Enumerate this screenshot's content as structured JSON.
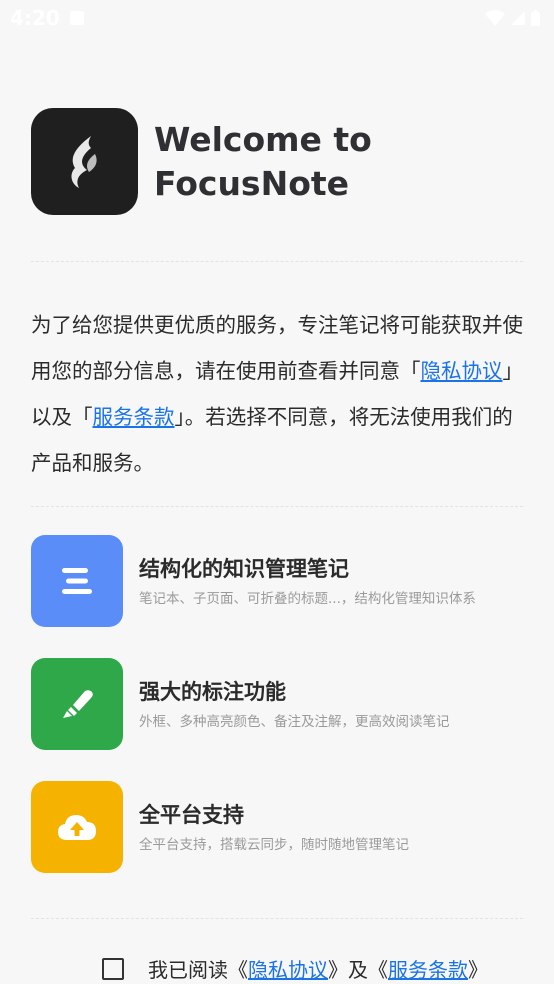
{
  "status": {
    "time": "4:20"
  },
  "header": {
    "line1": "Welcome to",
    "line2": "FocusNote"
  },
  "intro": {
    "part1": "为了给您提供更优质的服务，专注笔记将可能获取并使用您的部分信息，请在使用前查看并同意「",
    "privacy_link": "隐私协议",
    "part2": "」以及「",
    "terms_link": "服务条款",
    "part3": "」。若选择不同意，将无法使用我们的产品和服务。"
  },
  "features": [
    {
      "title": "结构化的知识管理笔记",
      "desc": "笔记本、子页面、可折叠的标题...，结构化管理知识体系",
      "color": "#5b8df8",
      "icon": "list-icon"
    },
    {
      "title": "强大的标注功能",
      "desc": "外框、多种高亮颜色、备注及注解，更高效阅读笔记",
      "color": "#2fa84a",
      "icon": "highlighter-icon"
    },
    {
      "title": "全平台支持",
      "desc": "全平台支持，搭载云同步，随时随地管理笔记",
      "color": "#f5b300",
      "icon": "cloud-upload-icon"
    }
  ],
  "agree": {
    "prefix": "我已阅读《",
    "privacy_link": "隐私协议",
    "middle": "》及《",
    "terms_link": "服务条款",
    "suffix": "》"
  }
}
